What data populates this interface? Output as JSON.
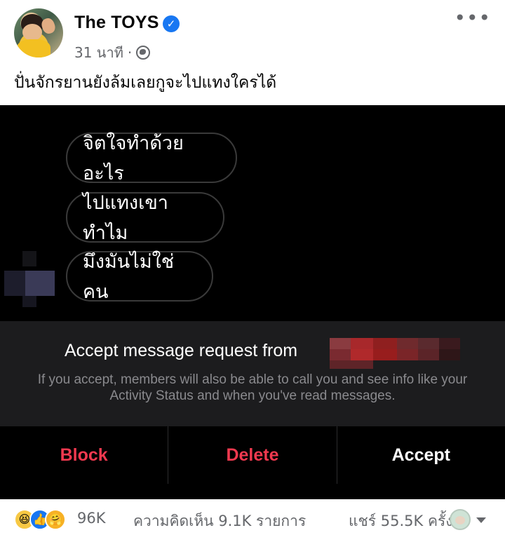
{
  "post": {
    "page_name": "The TOYS",
    "verified_mark": "✓",
    "time": "31 นาที",
    "dot": "·",
    "more": "•••",
    "caption": "ปั่นจักรยานยังล้มเลยกูจะไปแทงใครได้"
  },
  "screenshot": {
    "quick_replies": [
      "จิตใจทำด้วยอะไร",
      "ไปแทงเขาทำไม",
      "มึงมันไม่ใช่คน"
    ],
    "request_title": "Accept message request from ",
    "request_desc": "If you accept, members will also be able to call you and see info like your Activity Status and when you've read messages.",
    "actions": {
      "block": "Block",
      "delete": "Delete",
      "accept": "Accept"
    },
    "colors": {
      "danger": "#f0394f",
      "panel": "#1c1c1e"
    }
  },
  "footer": {
    "reaction_icons": [
      "haha-icon",
      "like-icon",
      "care-icon"
    ],
    "reaction_count": "96K",
    "comments": "ความคิดเห็น 9.1K รายการ",
    "shares": "แชร์ 55.5K ครั้ง"
  }
}
